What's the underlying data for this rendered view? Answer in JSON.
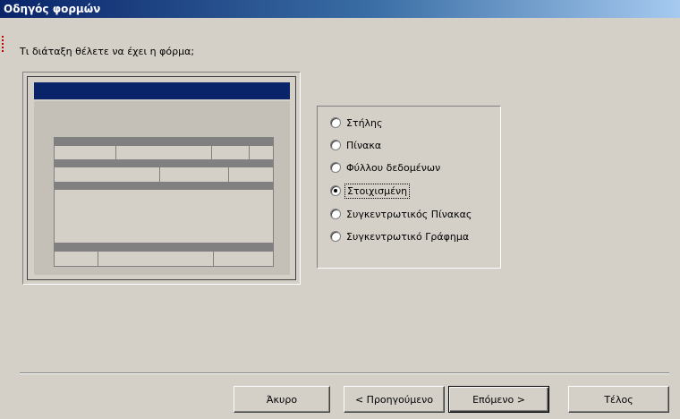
{
  "window": {
    "title": "Οδηγός φορμών"
  },
  "prompt": "Τι διάταξη θέλετε να έχει η φόρμα;",
  "layout_options": [
    {
      "label": "Στήλης",
      "checked": false
    },
    {
      "label": "Πίνακα",
      "checked": false
    },
    {
      "label": "Φύλλου δεδομένων",
      "checked": false
    },
    {
      "label": "Στοιχισμένη",
      "checked": true
    },
    {
      "label": "Συγκεντρωτικός Πίνακας",
      "checked": false
    },
    {
      "label": "Συγκεντρωτικό Γράφημα",
      "checked": false
    }
  ],
  "buttons": {
    "cancel": "Άκυρο",
    "back": "< Προηγούμενο",
    "next": "Επόμενο >",
    "finish": "Τέλος"
  },
  "colors": {
    "titlebar_start": "#0a246a",
    "titlebar_end": "#a6caf0",
    "dialog_bg": "#d4d0c8",
    "preview_title": "#0a246a"
  }
}
